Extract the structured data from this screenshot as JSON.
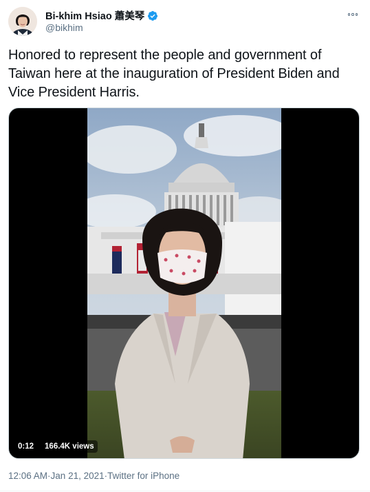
{
  "author": {
    "display_name": "Bi-khim Hsiao 蕭美琴",
    "handle": "@bikhim",
    "verified": true,
    "avatar_icon": "profile-photo"
  },
  "tweet": {
    "text": "Honored to represent the people and government of Taiwan here at the inauguration of President Biden and Vice President Harris."
  },
  "video": {
    "duration": "0:12",
    "views": "166.4K views"
  },
  "meta": {
    "time": "12:06 AM",
    "separator1": " · ",
    "date": "Jan 21, 2021",
    "separator2": " · ",
    "source": "Twitter for iPhone"
  },
  "colors": {
    "verified": "#1d9bf0",
    "secondary_text": "#5b7083"
  },
  "icons": [
    "verified-badge-icon",
    "more-options-icon"
  ]
}
